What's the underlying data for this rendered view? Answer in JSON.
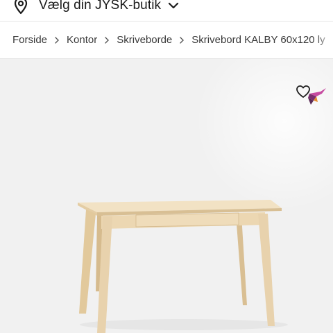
{
  "store_bar": {
    "label": "Vælg din JYSK-butik",
    "icon": "location-pin-icon",
    "toggle_icon": "chevron-down-icon"
  },
  "breadcrumb": {
    "items": [
      "Forside",
      "Kontor",
      "Skriveborde"
    ],
    "current": "Skrivebord KALBY 60x120 ly"
  },
  "product": {
    "favorite_icon": "heart-icon",
    "sticker_icon": "hummingbird-sticker-icon",
    "image_subject": "desk-image"
  },
  "colors": {
    "stage_background": "#f1f1f1",
    "text": "#1a1a1a",
    "wood": "#e8d2ad"
  }
}
